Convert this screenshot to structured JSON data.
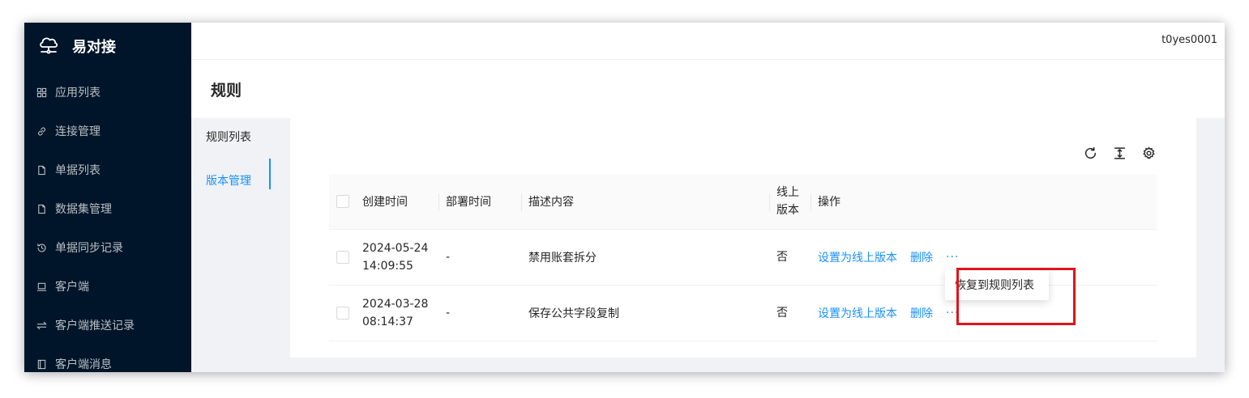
{
  "app": {
    "name": "易对接",
    "user": "t0yes0001"
  },
  "sidebar": {
    "items": [
      {
        "label": "应用列表",
        "icon": "grid-icon"
      },
      {
        "label": "连接管理",
        "icon": "link-icon"
      },
      {
        "label": "单据列表",
        "icon": "file-icon"
      },
      {
        "label": "数据集管理",
        "icon": "file-icon"
      },
      {
        "label": "单据同步记录",
        "icon": "history-icon"
      },
      {
        "label": "客户端",
        "icon": "laptop-icon"
      },
      {
        "label": "客户端推送记录",
        "icon": "swap-icon"
      },
      {
        "label": "客户端消息",
        "icon": "book-icon"
      }
    ]
  },
  "page": {
    "title": "规则"
  },
  "subnav": {
    "items": [
      {
        "label": "规则列表",
        "active": false
      },
      {
        "label": "版本管理",
        "active": true
      }
    ]
  },
  "table": {
    "columns": {
      "created": "创建时间",
      "deployed": "部署时间",
      "description": "描述内容",
      "online_line1": "线上",
      "online_line2": "版本",
      "actions": "操作"
    },
    "rows": [
      {
        "created_date": "2024-05-24",
        "created_time": "14:09:55",
        "deployed": "-",
        "description": "禁用账套拆分",
        "online": "否",
        "set_online": "设置为线上版本",
        "delete": "删除",
        "more": "···"
      },
      {
        "created_date": "2024-03-28",
        "created_time": "08:14:37",
        "deployed": "-",
        "description": "保存公共字段复制",
        "online": "否",
        "set_online": "设置为线上版本",
        "delete": "删除",
        "more": "···"
      }
    ]
  },
  "dropdown": {
    "restore": "恢复到规则列表"
  },
  "colors": {
    "primary": "#1890ff",
    "sidebar_bg": "#001529",
    "highlight": "#e3131b"
  }
}
